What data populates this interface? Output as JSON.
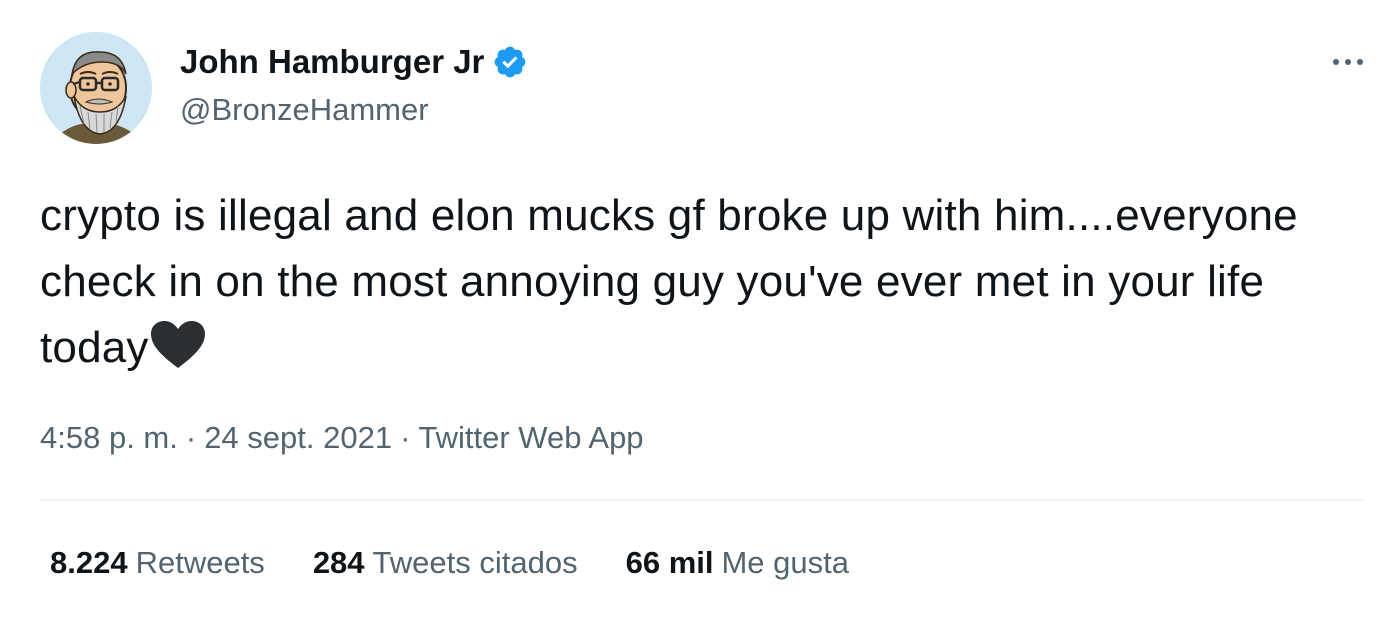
{
  "author": {
    "display_name": "John Hamburger Jr",
    "handle": "@BronzeHammer",
    "verified": true,
    "avatar_icon": "bearded-man-glasses-avatar"
  },
  "menu": {
    "icon": "more-dots-icon"
  },
  "tweet": {
    "text": "crypto is illegal and elon mucks gf broke up with him....everyone check in on the most annoying guy you've ever met in your life today",
    "emoji": "black-heart"
  },
  "meta": {
    "time": "4:58 p. m.",
    "separator": "·",
    "date": "24 sept. 2021",
    "source": "Twitter Web App"
  },
  "stats": {
    "retweets": {
      "count": "8.224",
      "label": "Retweets"
    },
    "quotes": {
      "count": "284",
      "label": "Tweets citados"
    },
    "likes": {
      "count": "66 mil",
      "label": "Me gusta"
    }
  },
  "colors": {
    "text_primary": "#0f1419",
    "text_secondary": "#536471",
    "verified_blue": "#1d9bf0",
    "divider": "#eff3f4"
  }
}
